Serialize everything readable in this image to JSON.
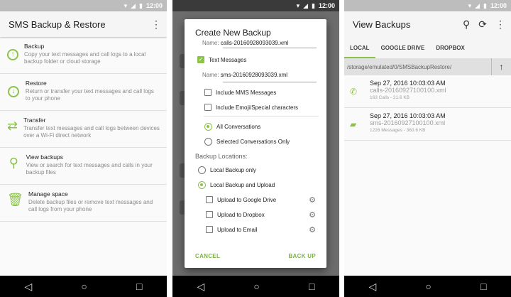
{
  "status_time": "12:00",
  "screen1": {
    "title": "SMS Backup & Restore",
    "items": [
      {
        "title": "Backup",
        "desc": "Copy your text messages and call logs to a local backup folder or cloud storage"
      },
      {
        "title": "Restore",
        "desc": "Return or transfer your text messages and call logs to your phone"
      },
      {
        "title": "Transfer",
        "desc": "Transfer text messages and call logs between devices over a Wi-Fi direct network"
      },
      {
        "title": "View backups",
        "desc": "View or search for text messages and calls in your backup files"
      },
      {
        "title": "Manage space",
        "desc": "Delete backup files or remove text messages and call logs from your phone"
      }
    ]
  },
  "screen2": {
    "title": "Create New Backup",
    "name_label_1": "Name:",
    "name_value_1": "calls-20160928093039.xml",
    "text_messages": "Text Messages",
    "name_label_2": "Name:",
    "name_value_2": "sms-20160928093039.xml",
    "include_mms": "Include MMS Messages",
    "include_emoji": "Include Emoji/Special characters",
    "all_conversations": "All Conversations",
    "selected_conversations": "Selected Conversations Only",
    "backup_locations": "Backup Locations:",
    "local_only": "Local Backup only",
    "local_upload": "Local Backup and Upload",
    "upload_drive": "Upload to Google Drive",
    "upload_dropbox": "Upload to Dropbox",
    "upload_email": "Upload to Email",
    "cancel": "CANCEL",
    "back_up": "BACK UP"
  },
  "screen3": {
    "title": "View Backups",
    "tabs": [
      "LOCAL",
      "GOOGLE DRIVE",
      "DROPBOX"
    ],
    "path": "/storage/emulated/0/SMSBackupRestore/",
    "backups": [
      {
        "date": "Sep 27, 2016 10:03:03 AM",
        "file": "calls-20160927100100.xml",
        "meta": "163 Calls - 21.6 KB"
      },
      {
        "date": "Sep 27, 2016 10:03:03 AM",
        "file": "sms-20160927100100.xml",
        "meta": "1226 Messages - 360.6 KB"
      }
    ]
  },
  "colors": {
    "accent": "#8bc34a",
    "toolbar": "#f5f5f5"
  }
}
